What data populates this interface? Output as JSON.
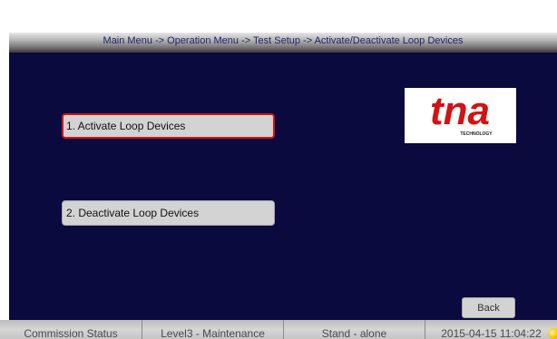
{
  "header": {
    "breadcrumb": "Main Menu -> Operation Menu -> Test Setup -> Activate/Deactivate Loop Devices"
  },
  "menu": {
    "items": [
      {
        "label": "1. Activate Loop Devices",
        "selected": true
      },
      {
        "label": "2. Deactivate Loop Devices",
        "selected": false
      }
    ]
  },
  "logo": {
    "brand": "tna",
    "tagline": "TECHNOLOGY",
    "color": "#d31313"
  },
  "actions": {
    "back_label": "Back"
  },
  "status_bar": {
    "commission_status": "Commission Status",
    "access_level": "Level3 - Maintenance",
    "mode": "Stand - alone",
    "datetime": "2015-04-15 11:04:22",
    "indicator_color": "#f5c800"
  },
  "colors": {
    "background": "#0a0a3e",
    "selection_border": "#d31313",
    "button_face": "#d3d3d3"
  }
}
